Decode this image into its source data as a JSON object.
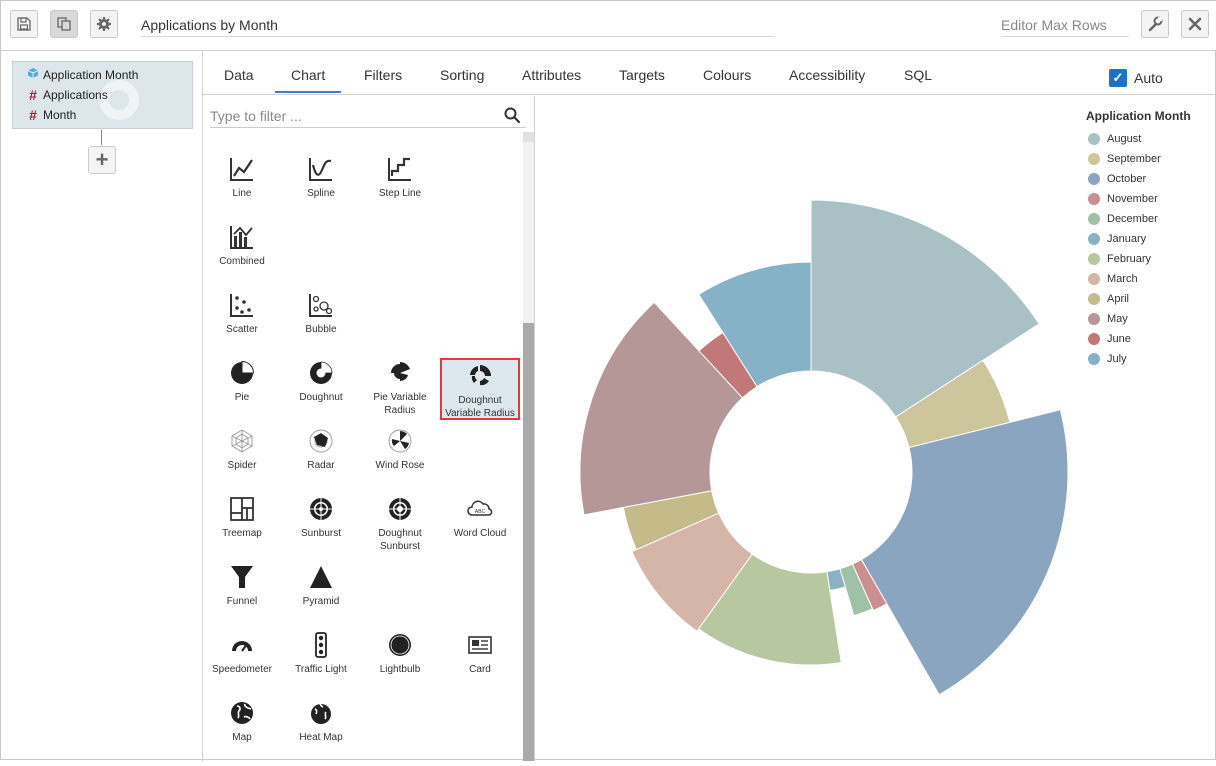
{
  "header": {
    "title": "Applications by Month",
    "max_rows_placeholder": "Editor Max Rows"
  },
  "fields": [
    {
      "label": "Application Month",
      "icon": "cube-icon"
    },
    {
      "label": "Applications",
      "icon": "hash-icon"
    },
    {
      "label": "Month",
      "icon": "hash-icon"
    }
  ],
  "tabs": [
    "Data",
    "Chart",
    "Filters",
    "Sorting",
    "Attributes",
    "Targets",
    "Colours",
    "Accessibility",
    "SQL"
  ],
  "active_tab": "Chart",
  "auto_label": "Auto",
  "filter_placeholder": "Type to filter ...",
  "chart_types": [
    {
      "label": "Line",
      "icon": "line-chart-icon"
    },
    {
      "label": "Spline",
      "icon": "spline-chart-icon"
    },
    {
      "label": "Step Line",
      "icon": "step-line-chart-icon"
    },
    {
      "label": "Combined",
      "icon": "combined-chart-icon"
    },
    {
      "label": "Scatter",
      "icon": "scatter-chart-icon"
    },
    {
      "label": "Bubble",
      "icon": "bubble-chart-icon"
    },
    {
      "label": "Pie",
      "icon": "pie-chart-icon"
    },
    {
      "label": "Doughnut",
      "icon": "doughnut-chart-icon"
    },
    {
      "label": "Pie Variable Radius",
      "icon": "pie-variable-radius-icon"
    },
    {
      "label": "Doughnut Variable Radius",
      "icon": "doughnut-variable-radius-icon",
      "selected": true
    },
    {
      "label": "Spider",
      "icon": "spider-chart-icon"
    },
    {
      "label": "Radar",
      "icon": "radar-chart-icon"
    },
    {
      "label": "Wind Rose",
      "icon": "wind-rose-icon"
    },
    {
      "label": "Treemap",
      "icon": "treemap-icon"
    },
    {
      "label": "Sunburst",
      "icon": "sunburst-icon"
    },
    {
      "label": "Doughnut Sunburst",
      "icon": "doughnut-sunburst-icon"
    },
    {
      "label": "Word Cloud",
      "icon": "word-cloud-icon"
    },
    {
      "label": "Funnel",
      "icon": "funnel-icon"
    },
    {
      "label": "Pyramid",
      "icon": "pyramid-icon"
    },
    {
      "label": "Speedometer",
      "icon": "speedometer-icon"
    },
    {
      "label": "Traffic Light",
      "icon": "traffic-light-icon"
    },
    {
      "label": "Lightbulb",
      "icon": "lightbulb-icon"
    },
    {
      "label": "Card",
      "icon": "card-icon"
    },
    {
      "label": "Map",
      "icon": "map-icon"
    },
    {
      "label": "Heat Map",
      "icon": "heat-map-icon"
    }
  ],
  "chart_data": {
    "type": "doughnut-variable-radius",
    "legend_title": "Application Month",
    "legend_position": "top-right",
    "categories": [
      "August",
      "September",
      "October",
      "November",
      "December",
      "January",
      "February",
      "March",
      "April",
      "May",
      "June",
      "July"
    ],
    "colors": [
      "#a9c1c5",
      "#cdc59c",
      "#8aa5c0",
      "#cc8f8f",
      "#9fc2a7",
      "#8bb2c4",
      "#b7c79f",
      "#d4b5a8",
      "#c4bb88",
      "#b59797",
      "#c27878",
      "#86b2c7"
    ],
    "angles": [
      60,
      20,
      78,
      6,
      8,
      8,
      47,
      32,
      14,
      61,
      11,
      34
    ],
    "radius": [
      272,
      205,
      257,
      152,
      150,
      120,
      193,
      196,
      191,
      231,
      165,
      210
    ]
  }
}
